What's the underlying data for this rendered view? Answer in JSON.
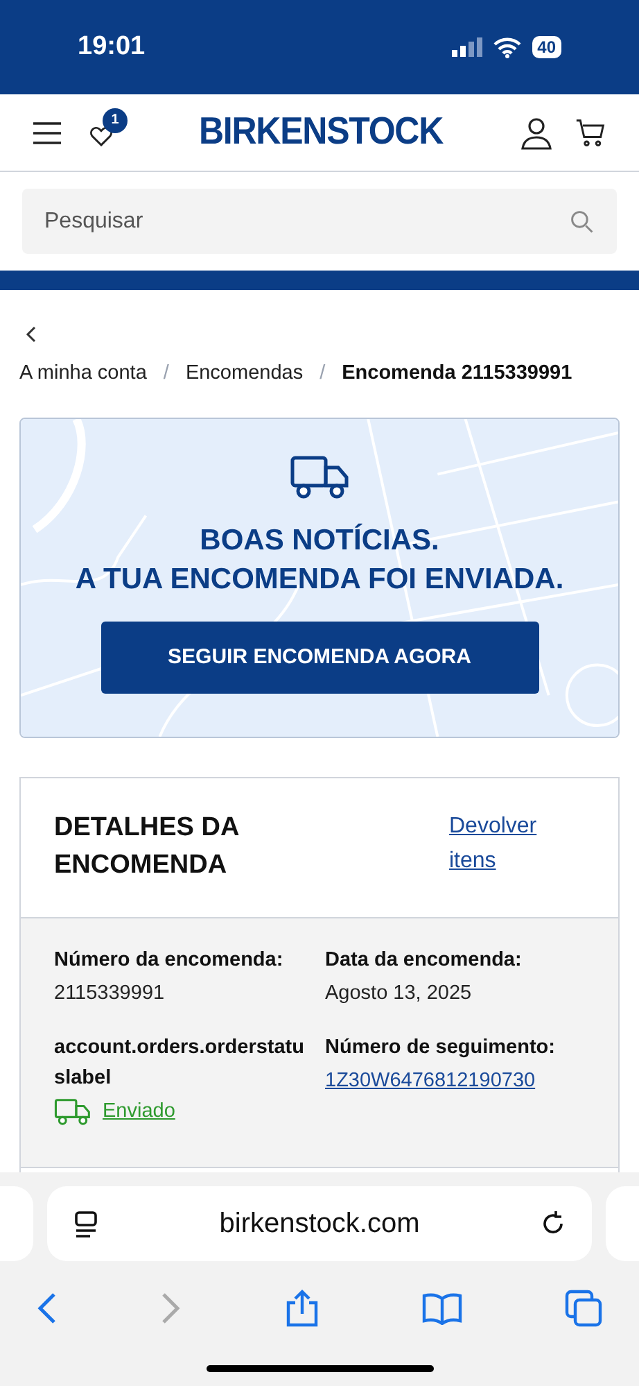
{
  "status_bar": {
    "time": "19:01",
    "battery": "40"
  },
  "header": {
    "logo": "BIRKENSTOCK",
    "wishlist_count": "1"
  },
  "search": {
    "placeholder": "Pesquisar"
  },
  "breadcrumb": [
    {
      "label": "A minha conta",
      "current": false
    },
    {
      "label": "Encomendas",
      "current": false
    },
    {
      "label": "Encomenda 2115339991",
      "current": true
    }
  ],
  "separator": "/",
  "banner": {
    "kind": "picture",
    "title_lines": [
      "BOAS NOTÍCIAS.",
      "A TUA ENCOMENDA FOI ENVIADA."
    ],
    "button": "SEGUIR ENCOMENDA AGORA"
  },
  "details": {
    "title": "DETALHES DA ENCOMENDA",
    "link": "Devolver itens",
    "fields": [
      {
        "label": "Número da encomenda:",
        "value": "2115339991",
        "kind": "text"
      },
      {
        "label": "Data da encomenda:",
        "value": "Agosto 13, 2025",
        "kind": "text"
      },
      {
        "label": "account.orders.orderstatuslabel",
        "value": "Enviado",
        "kind": "status"
      },
      {
        "label": "Número de seguimento:",
        "value": "1Z30W6476812190730",
        "kind": "link"
      }
    ]
  },
  "browser": {
    "url": "birkenstock.com"
  }
}
